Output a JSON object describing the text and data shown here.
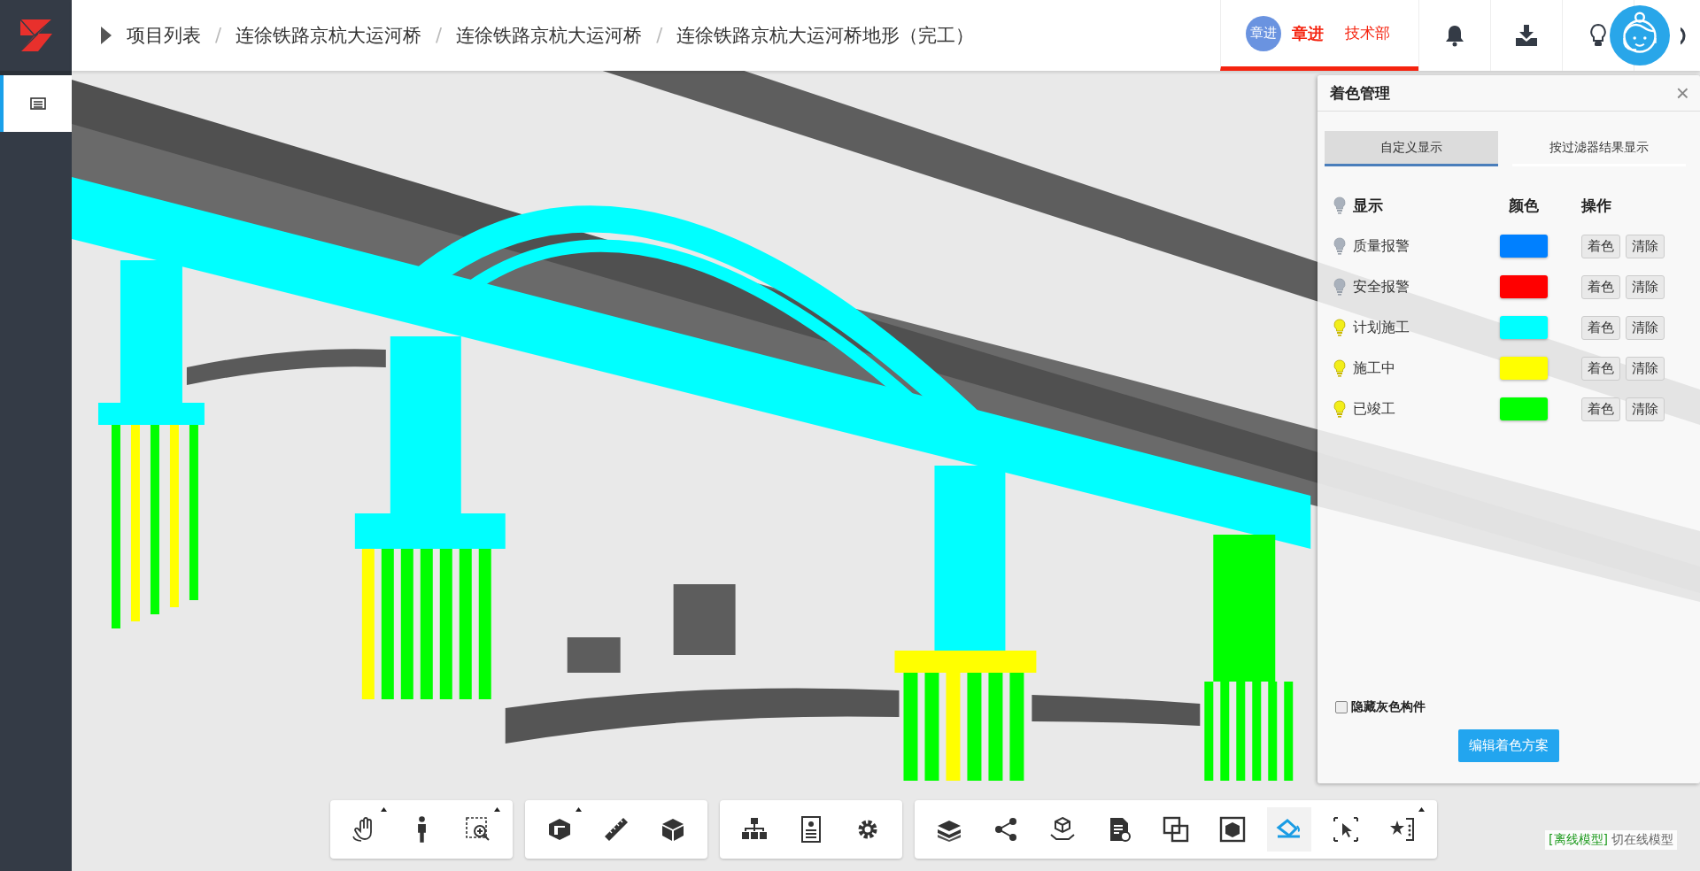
{
  "sidebar": {
    "items": [
      {
        "selected": true
      }
    ]
  },
  "breadcrumb": {
    "separator": "/",
    "items": [
      "项目列表",
      "连徐铁路京杭大运河桥",
      "连徐铁路京杭大运河桥",
      "连徐铁路京杭大运河桥地形（完工）"
    ]
  },
  "user": {
    "avatar_text": "章进",
    "name": "章进",
    "department": "技术部",
    "selected": true
  },
  "color_panel": {
    "title": "着色管理",
    "close": "×",
    "tabs": [
      {
        "label": "自定义显示",
        "selected": true
      },
      {
        "label": "按过滤器结果显示",
        "selected": false
      }
    ],
    "columns": {
      "show": "显示",
      "show_on": false,
      "color_heading": "颜色",
      "actions": "操作"
    },
    "rows": [
      {
        "name": "质量报警",
        "on": false,
        "color": "#0080ff",
        "apply": "着色",
        "clear": "清除"
      },
      {
        "name": "安全报警",
        "on": false,
        "color": "#ff0000",
        "apply": "着色",
        "clear": "清除"
      },
      {
        "name": "计划施工",
        "on": true,
        "color": "#00ffff",
        "apply": "着色",
        "clear": "清除"
      },
      {
        "name": "施工中",
        "on": true,
        "color": "#ffff00",
        "apply": "着色",
        "clear": "清除"
      },
      {
        "name": "已竣工",
        "on": true,
        "color": "#00ff00",
        "apply": "着色",
        "clear": "清除"
      }
    ],
    "hide_gray": {
      "label": "隐藏灰色构件",
      "checked": false
    },
    "edit_button": "编辑着色方案"
  },
  "toolbar": [
    [
      {
        "kind": "hand",
        "has_menu": true,
        "selected": false
      },
      {
        "kind": "person",
        "has_menu": false,
        "selected": false
      },
      {
        "kind": "zoom",
        "has_menu": true,
        "selected": false
      }
    ],
    [
      {
        "kind": "section",
        "has_menu": true,
        "selected": false
      },
      {
        "kind": "ruler",
        "has_menu": false,
        "selected": false
      },
      {
        "kind": "box",
        "has_menu": false,
        "selected": false
      }
    ],
    [
      {
        "kind": "tree",
        "has_menu": false,
        "selected": false
      },
      {
        "kind": "properties",
        "has_menu": false,
        "selected": false
      },
      {
        "kind": "gear",
        "has_menu": false,
        "selected": false
      }
    ],
    [
      {
        "kind": "books",
        "has_menu": false,
        "selected": false
      },
      {
        "kind": "share",
        "has_menu": false,
        "selected": false
      },
      {
        "kind": "cubehand",
        "has_menu": false,
        "selected": false
      },
      {
        "kind": "document",
        "has_menu": false,
        "selected": false
      },
      {
        "kind": "overlap",
        "has_menu": false,
        "selected": false
      },
      {
        "kind": "cubeframe",
        "has_menu": false,
        "selected": false
      },
      {
        "kind": "paint",
        "has_menu": false,
        "selected": true
      },
      {
        "kind": "select",
        "has_menu": false,
        "selected": false
      },
      {
        "kind": "star",
        "has_menu": true,
        "selected": false
      }
    ]
  ],
  "model_mode": {
    "current": "[离线模型]",
    "switch": "切在线模型"
  }
}
